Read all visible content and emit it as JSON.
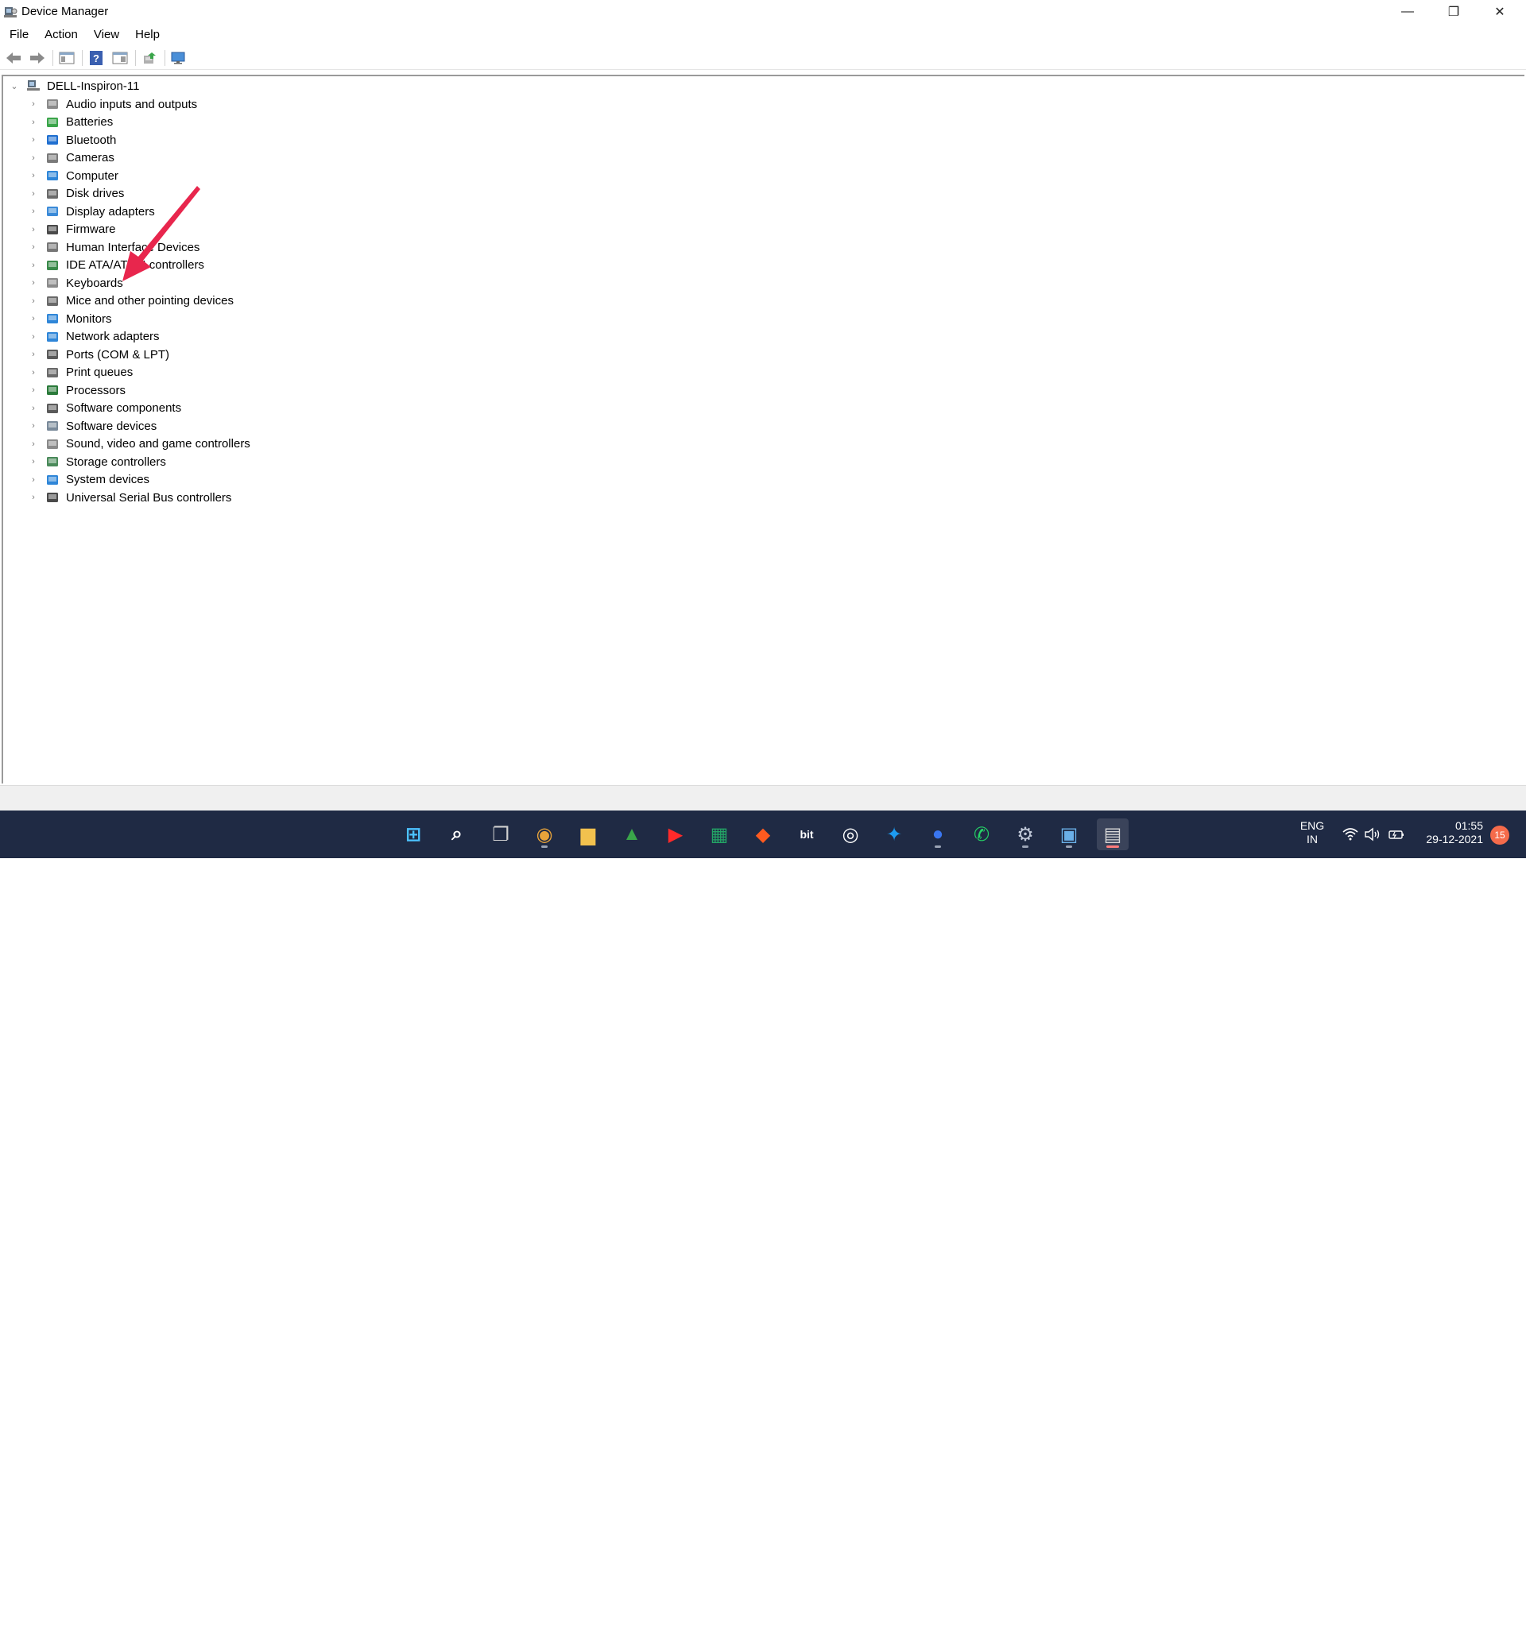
{
  "window": {
    "title": "Device Manager",
    "controls": {
      "minimize": "—",
      "restore": "❐",
      "close": "✕"
    }
  },
  "menu": [
    "File",
    "Action",
    "View",
    "Help"
  ],
  "toolbar": {
    "buttons": [
      "back-icon",
      "forward-icon",
      "show-hide-console-tree-icon",
      "help-icon",
      "properties-icon",
      "update-driver-icon",
      "scan-hardware-icon"
    ]
  },
  "tree": {
    "root": "DELL-Inspiron-11",
    "items": [
      {
        "label": "Audio inputs and outputs",
        "icon": "speaker-icon"
      },
      {
        "label": "Batteries",
        "icon": "battery-icon"
      },
      {
        "label": "Bluetooth",
        "icon": "bluetooth-icon"
      },
      {
        "label": "Cameras",
        "icon": "camera-icon"
      },
      {
        "label": "Computer",
        "icon": "computer-icon"
      },
      {
        "label": "Disk drives",
        "icon": "disk-drive-icon"
      },
      {
        "label": "Display adapters",
        "icon": "display-adapter-icon"
      },
      {
        "label": "Firmware",
        "icon": "firmware-icon"
      },
      {
        "label": "Human Interface Devices",
        "icon": "hid-icon"
      },
      {
        "label": "IDE ATA/ATAPI controllers",
        "icon": "ide-controller-icon"
      },
      {
        "label": "Keyboards",
        "icon": "keyboard-icon"
      },
      {
        "label": "Mice and other pointing devices",
        "icon": "mouse-icon"
      },
      {
        "label": "Monitors",
        "icon": "monitor-icon"
      },
      {
        "label": "Network adapters",
        "icon": "network-adapter-icon"
      },
      {
        "label": "Ports (COM & LPT)",
        "icon": "port-icon"
      },
      {
        "label": "Print queues",
        "icon": "printer-icon"
      },
      {
        "label": "Processors",
        "icon": "processor-icon"
      },
      {
        "label": "Software components",
        "icon": "software-component-icon"
      },
      {
        "label": "Software devices",
        "icon": "software-device-icon"
      },
      {
        "label": "Sound, video and game controllers",
        "icon": "sound-controller-icon"
      },
      {
        "label": "Storage controllers",
        "icon": "storage-controller-icon"
      },
      {
        "label": "System devices",
        "icon": "system-device-icon"
      },
      {
        "label": "Universal Serial Bus controllers",
        "icon": "usb-icon"
      }
    ]
  },
  "taskbar": {
    "apps": [
      "start-icon",
      "search-icon",
      "task-view-icon",
      "chrome-icon",
      "file-explorer-icon",
      "google-drive-icon",
      "youtube-icon",
      "google-sheets-icon",
      "brave-icon",
      "bit-icon",
      "cortana-icon",
      "twitter-icon",
      "signal-icon",
      "whatsapp-icon",
      "settings-icon",
      "control-panel-icon",
      "device-manager-icon"
    ]
  },
  "tray": {
    "language": "ENG",
    "region": "IN",
    "time": "01:55",
    "date": "29-12-2021",
    "notifications": "15"
  },
  "colors": {
    "taskbar": "#1f2a44",
    "annotation_arrow": "#e8264d",
    "accent": "#0078d4"
  }
}
